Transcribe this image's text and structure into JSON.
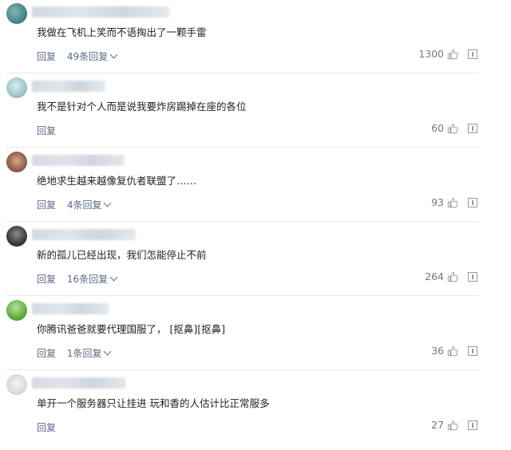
{
  "comments": [
    {
      "text": "我做在飞机上笑而不语掏出了一颗手雷",
      "reply": "回复",
      "replies": "49条回复",
      "likes": "1300"
    },
    {
      "text": "我不是针对个人而是说我要炸房踢掉在座的各位",
      "reply": "回复",
      "replies": "",
      "likes": "60"
    },
    {
      "text": "绝地求生越来越像复仇者联盟了……",
      "reply": "回复",
      "replies": "4条回复",
      "likes": "93"
    },
    {
      "text": "新的孤儿已经出现，我们怎能停止不前",
      "reply": "回复",
      "replies": "16条回复",
      "likes": "264"
    },
    {
      "text": "你腾讯爸爸就要代理国服了， [抠鼻][抠鼻]",
      "reply": "回复",
      "replies": "1条回复",
      "likes": "36"
    },
    {
      "text": "单开一个服务器只让挂进 玩和香的人估计比正常服多",
      "reply": "回复",
      "replies": "",
      "likes": "27"
    }
  ],
  "icons": {
    "like": "thumbs-up-icon",
    "report": "report-icon",
    "expand": "chevron-down-icon"
  },
  "colors": {
    "link": "#5b6c86",
    "divider": "#e9e9e9"
  }
}
